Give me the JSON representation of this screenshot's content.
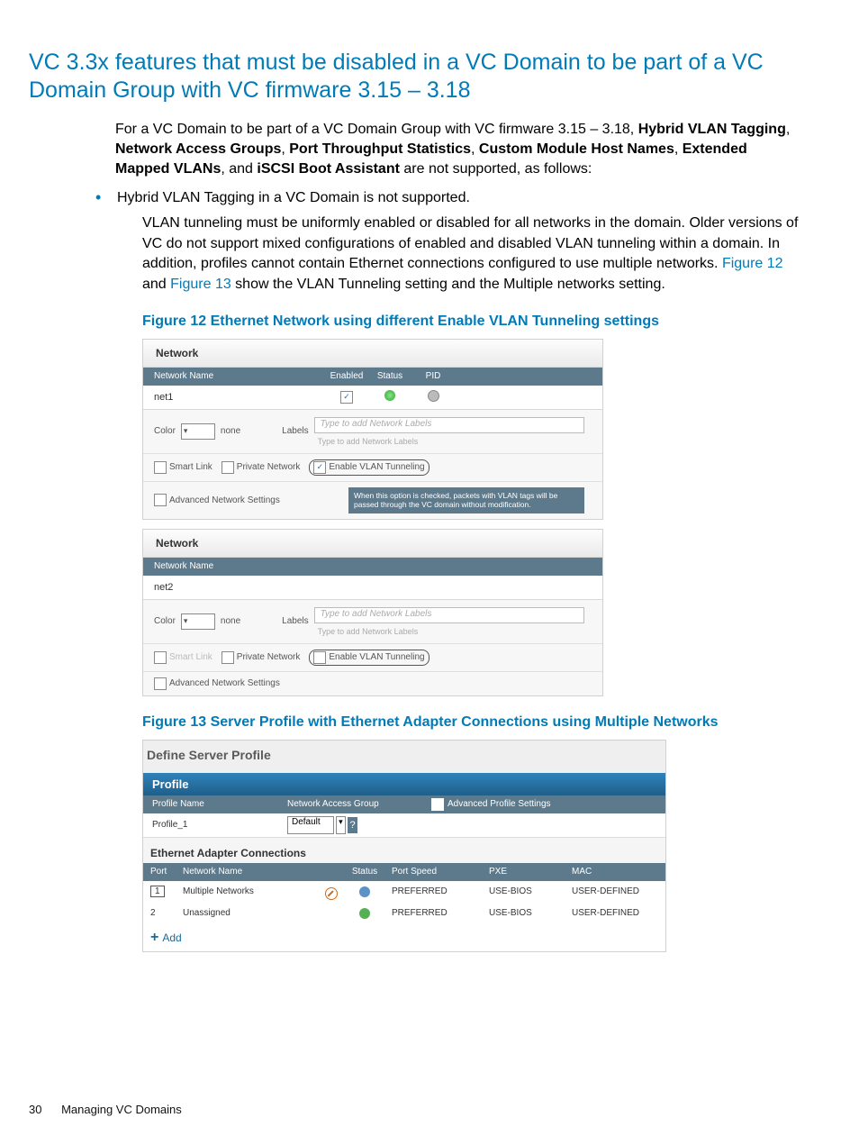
{
  "section_title": "VC 3.3x features that must be disabled in a VC Domain to be part of a VC Domain Group with VC firmware 3.15 – 3.18",
  "intro": {
    "prefix": "For a VC Domain to be part of a VC Domain Group with VC firmware 3.15 – 3.18, ",
    "bold1": "Hybrid VLAN Tagging",
    "sep1": ", ",
    "bold2": "Network Access Groups",
    "sep2": ", ",
    "bold3": "Port Throughput Statistics",
    "sep3": ", ",
    "bold4": "Custom Module Host Names",
    "sep4": ", ",
    "bold5": "Extended Mapped VLANs",
    "sep5": ", and ",
    "bold6": "iSCSI Boot Assistant",
    "suffix": " are not supported, as follows:"
  },
  "bullet1": "Hybrid VLAN Tagging in a VC Domain is not supported.",
  "bullet1_para_a": "VLAN tunneling must be uniformly enabled or disabled for all networks in the domain. Older versions of VC do not support mixed configurations of enabled and disabled VLAN tunneling within a domain. In addition, profiles cannot contain Ethernet connections configured to use multiple networks. ",
  "link_fig12": "Figure 12",
  "bullet1_para_b": " and ",
  "link_fig13": "Figure 13",
  "bullet1_para_c": " show the VLAN Tunneling setting and the Multiple networks setting.",
  "fig12_caption": "Figure 12 Ethernet Network using different Enable VLAN Tunneling settings",
  "fig12": {
    "panel_heading": "Network",
    "hdr_network_name": "Network Name",
    "hdr_enabled": "Enabled",
    "hdr_status": "Status",
    "hdr_pid": "PID",
    "net1_name": "net1",
    "color_lbl": "Color",
    "color_none": "none",
    "labels_lbl": "Labels",
    "labels_placeholder": "Type to add Network Labels",
    "cb_smartlink": "Smart Link",
    "cb_private": "Private Network",
    "cb_vlantunnel": "Enable VLAN Tunneling",
    "cb_adv": "Advanced Network Settings",
    "tooltip": "When this option is checked, packets with VLAN tags will be passed through the VC domain without modification.",
    "net2_name": "net2"
  },
  "fig13_caption": "Figure 13 Server Profile with Ethernet Adapter Connections using Multiple Networks",
  "fig13": {
    "title": "Define Server Profile",
    "profile_hdr": "Profile",
    "sub_profile_name": "Profile Name",
    "sub_nag": "Network Access Group",
    "cb_adv_profile": "Advanced Profile Settings",
    "profile_name_val": "Profile_1",
    "nag_val": "Default",
    "eac_title": "Ethernet Adapter Connections",
    "eac_hdr_port": "Port",
    "eac_hdr_net": "Network Name",
    "eac_hdr_status": "Status",
    "eac_hdr_speed": "Port Speed",
    "eac_hdr_pxe": "PXE",
    "eac_hdr_mac": "MAC",
    "row1_port": "1",
    "row1_net": "Multiple Networks",
    "row1_speed": "PREFERRED",
    "row1_pxe": "USE-BIOS",
    "row1_mac": "USER-DEFINED",
    "row2_port": "2",
    "row2_net": "Unassigned",
    "row2_speed": "PREFERRED",
    "row2_pxe": "USE-BIOS",
    "row2_mac": "USER-DEFINED",
    "add": "Add"
  },
  "footer_page": "30",
  "footer_text": "Managing VC Domains"
}
